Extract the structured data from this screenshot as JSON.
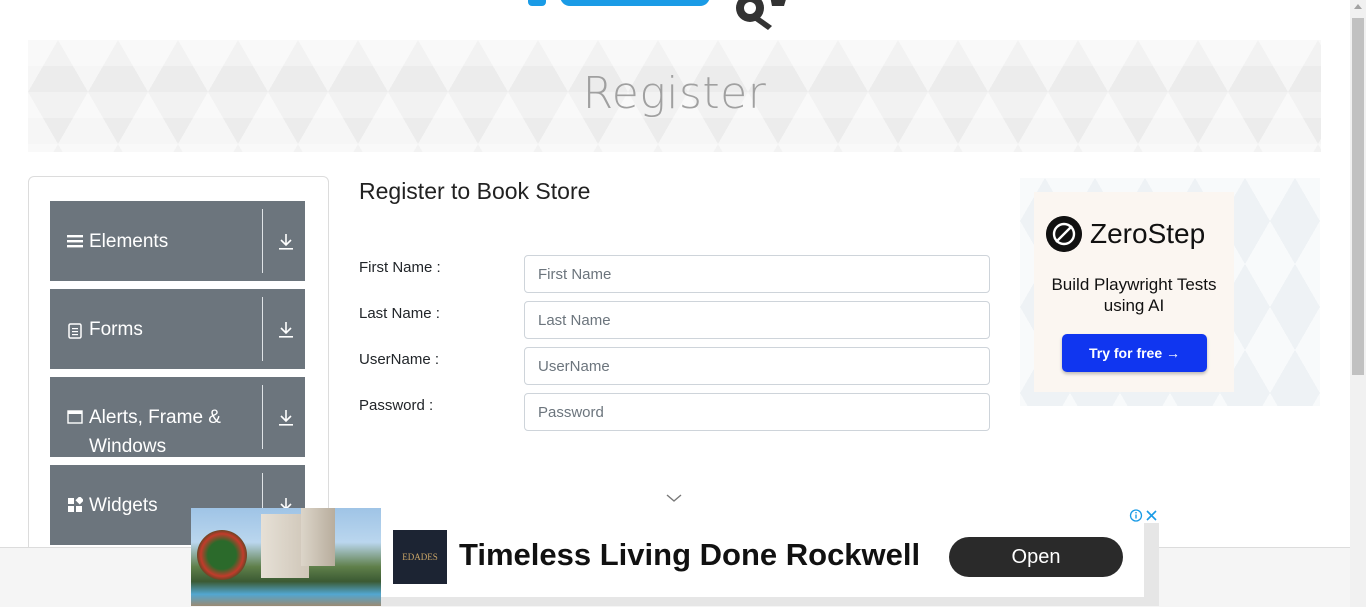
{
  "banner": {
    "title": "Register"
  },
  "sidebar": {
    "groups": [
      {
        "label": "Elements",
        "icon": "hamburger-icon"
      },
      {
        "label": "Forms",
        "icon": "document-icon"
      },
      {
        "label": "Alerts, Frame & Windows",
        "icon": "window-icon"
      },
      {
        "label": "Widgets",
        "icon": "widgets-icon"
      }
    ]
  },
  "form": {
    "title": "Register to Book Store",
    "fields": [
      {
        "label": "First Name :",
        "placeholder": "First Name"
      },
      {
        "label": "Last Name :",
        "placeholder": "Last Name"
      },
      {
        "label": "UserName :",
        "placeholder": "UserName"
      },
      {
        "label": "Password :",
        "placeholder": "Password"
      }
    ]
  },
  "ad_right": {
    "brand": "ZeroStep",
    "tagline": "Build Playwright Tests using AI",
    "cta": "Try for free →",
    "accent": "#1036f0"
  },
  "ad_bottom": {
    "brand_logo_text": "EDADES",
    "headline": "Timeless Living Done Rockwell",
    "cta": "Open"
  },
  "colors": {
    "menu_bg": "#6c757d",
    "banner_title": "#a0a0a0"
  }
}
